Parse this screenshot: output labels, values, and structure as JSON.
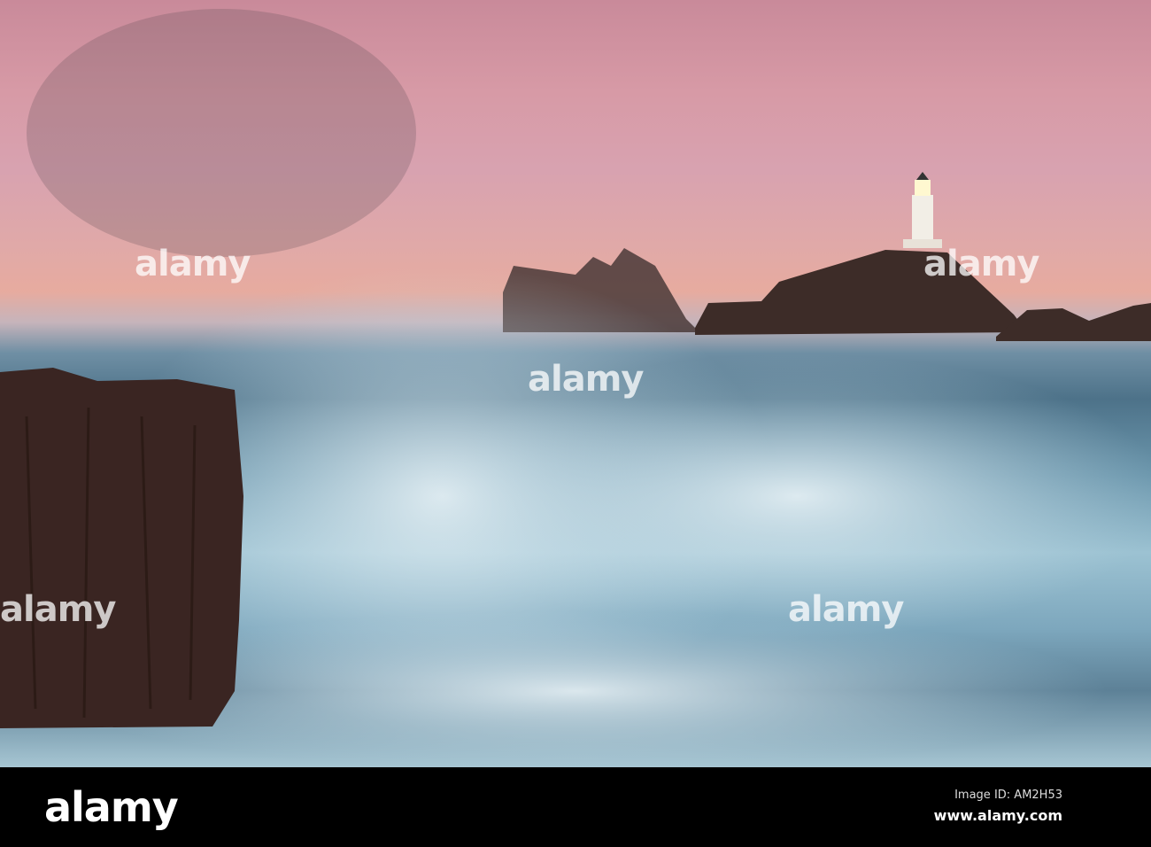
{
  "photo": {
    "subject": "Lighthouse on rocky islet at sunset with crashing waves",
    "watermark": "alamy"
  },
  "footer": {
    "logo": "alamy",
    "image_id": "Image ID: AM2H53",
    "url": "www.alamy.com"
  }
}
